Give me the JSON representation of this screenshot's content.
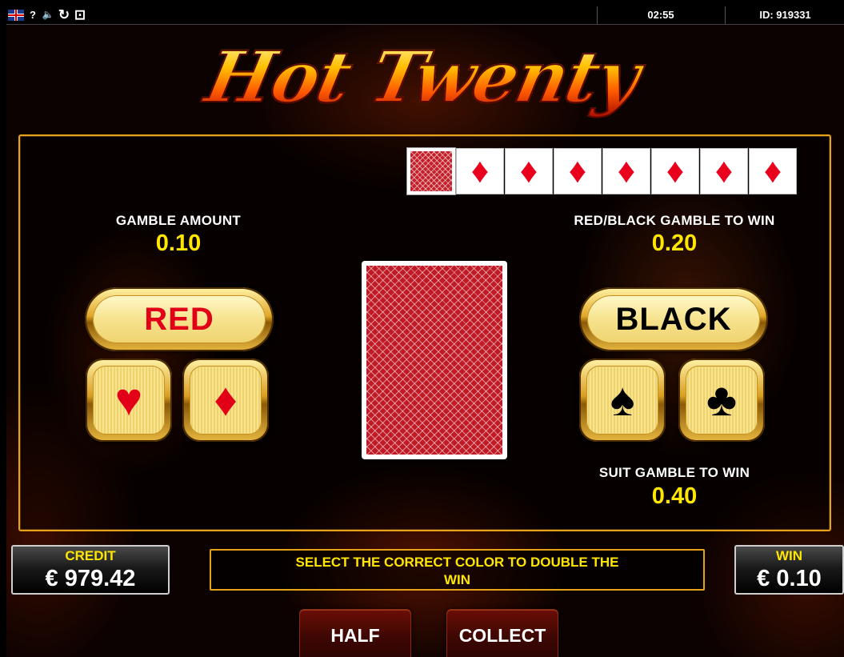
{
  "topbar": {
    "icons": [
      "uk-flag-icon",
      "help-icon",
      "sound-icon",
      "refresh-icon",
      "fullscreen-icon"
    ],
    "help_glyph": "?",
    "sound_glyph": "🔈",
    "refresh_glyph": "↻",
    "fullscreen_glyph": "⊡",
    "time": "02:55",
    "id": "ID: 919331"
  },
  "title": "Hot Twenty",
  "history": {
    "cards": [
      "back",
      "diamond",
      "diamond",
      "diamond",
      "diamond",
      "diamond",
      "diamond",
      "diamond"
    ],
    "diamond_glyph": "♦"
  },
  "gamble_amount": {
    "label": "GAMBLE AMOUNT",
    "value": "0.10"
  },
  "red_black_win": {
    "label": "RED/BLACK GAMBLE TO WIN",
    "value": "0.20"
  },
  "suit_win": {
    "label": "SUIT GAMBLE TO WIN",
    "value": "0.40"
  },
  "buttons": {
    "red": "RED",
    "black": "BLACK",
    "heart_glyph": "♥",
    "diamond_glyph": "♦",
    "spade_glyph": "♠",
    "club_glyph": "♣",
    "half": "HALF",
    "collect": "COLLECT"
  },
  "credit": {
    "label": "CREDIT",
    "value": "€ 979.42"
  },
  "win": {
    "label": "WIN",
    "value": "€ 0.10"
  },
  "message": "SELECT THE CORRECT COLOR TO DOUBLE THE WIN",
  "colors": {
    "accent": "#e8a21a",
    "value_yellow": "#ffe600",
    "red_text": "#e20018",
    "card_red": "#c01a26"
  }
}
